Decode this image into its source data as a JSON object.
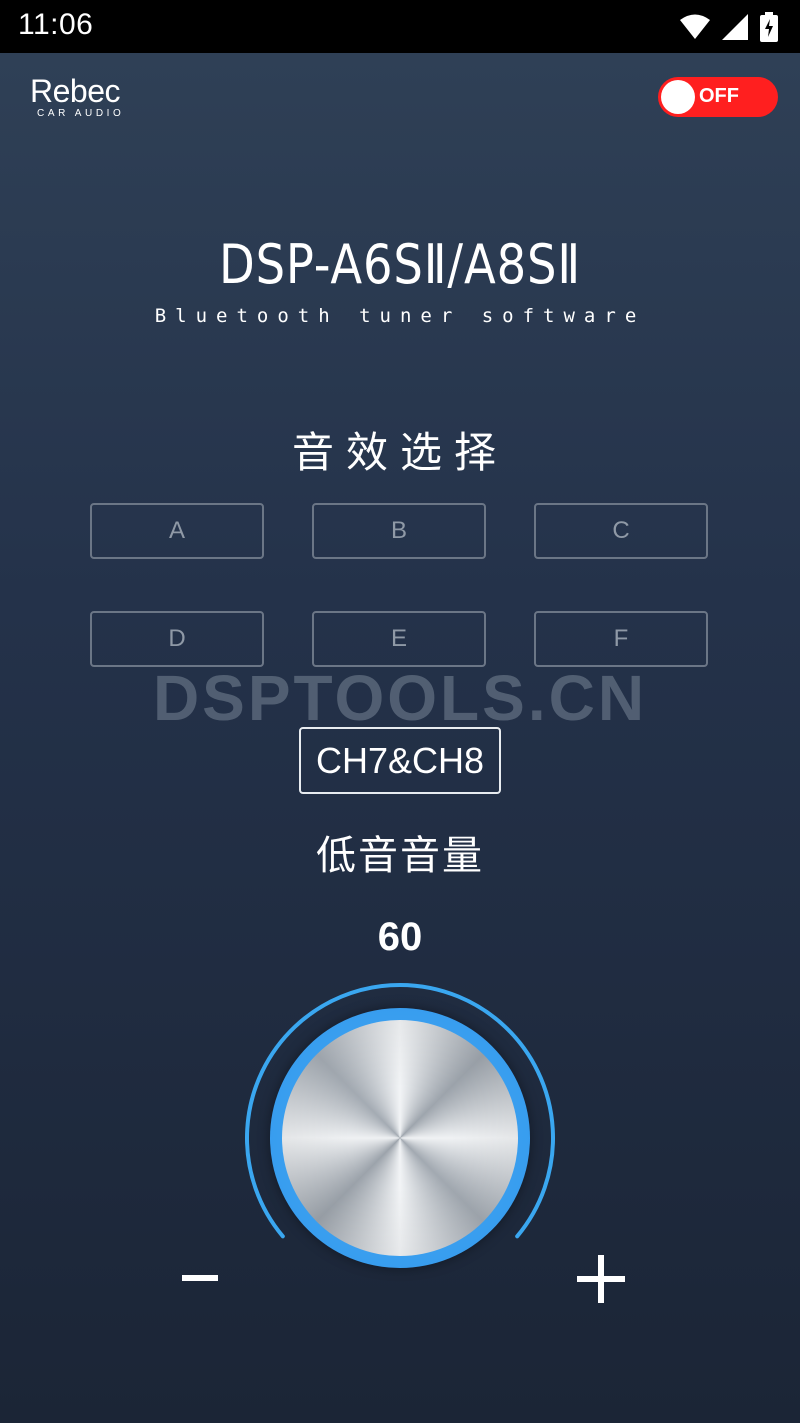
{
  "status_bar": {
    "time": "11:06",
    "icons": [
      "wifi-icon",
      "cell-signal-icon",
      "battery-charging-icon"
    ]
  },
  "header": {
    "logo_main": "Rebec",
    "logo_sub": "CAR AUDIO",
    "power_toggle": {
      "label": "OFF",
      "state": "off",
      "color": "#ff1f1f"
    }
  },
  "product": {
    "title": "DSP-A6SⅡ/A8SⅡ",
    "subtitle": "Bluetooth tuner software"
  },
  "sound_effect": {
    "title": "音效选择",
    "presets": [
      "A",
      "B",
      "C",
      "D",
      "E",
      "F"
    ]
  },
  "watermark": "DSPTOOLS.CN",
  "channel": {
    "label": "CH7&CH8"
  },
  "volume": {
    "label": "低音音量",
    "value": "60",
    "minus_symbol": "−",
    "plus_symbol": "+",
    "accent_color": "#3aa7f0"
  },
  "colors": {
    "background_top": "#2f4056",
    "background_bottom": "#1b2536",
    "preset_border": "#6b7686"
  }
}
